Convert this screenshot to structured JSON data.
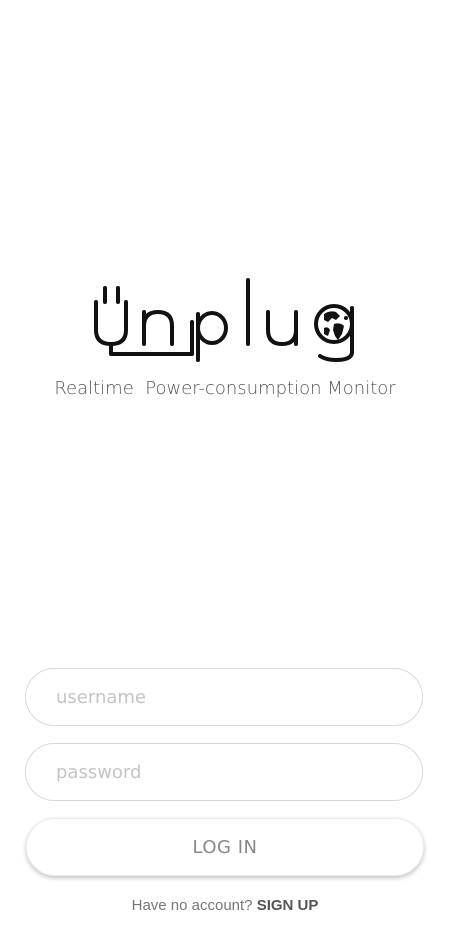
{
  "app": {
    "name": "unplug",
    "tagline": "Realtime  Power-consumption Monitor",
    "logo_icon": "plug-globe-logo"
  },
  "login_form": {
    "username_placeholder": "username",
    "password_placeholder": "password",
    "login_label": "LOG IN",
    "signup_prompt": "Have no account?",
    "signup_label": "SIGN UP"
  },
  "colors": {
    "background": "#ffffff",
    "logo": "#111111",
    "tagline": "#555555",
    "placeholder": "#c4c4c4",
    "button_text": "#888888"
  }
}
